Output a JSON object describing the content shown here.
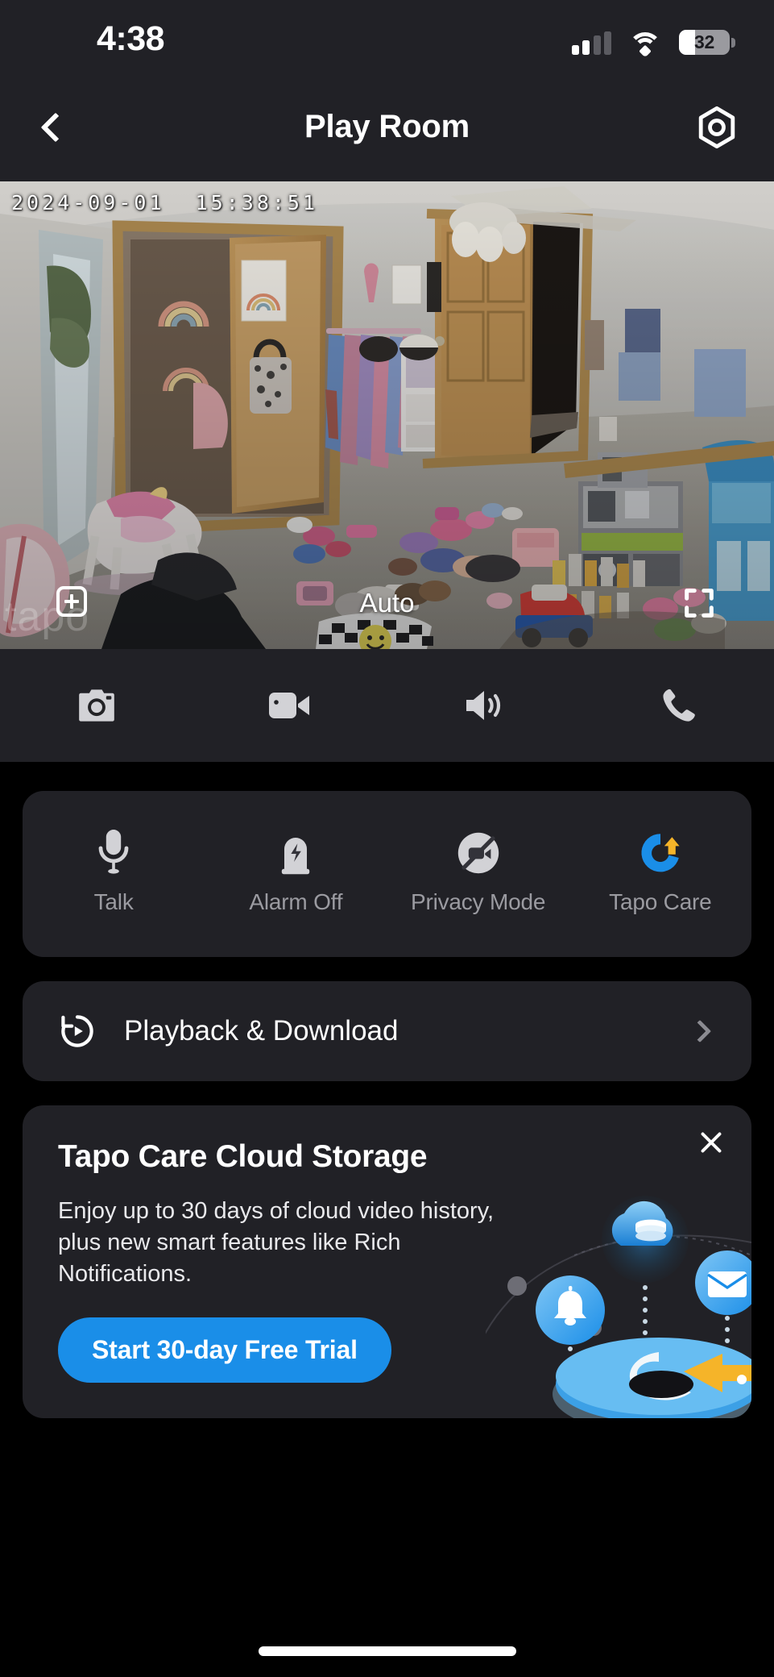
{
  "status_bar": {
    "time": "4:38",
    "battery_percent": "32",
    "battery_level": 32,
    "cellular_bars_filled": 2,
    "cellular_bars_total": 4,
    "wifi_icon": "wifi-icon"
  },
  "header": {
    "title": "Play Room",
    "back_icon": "chevron-left-icon",
    "settings_icon": "settings-hexagon-icon"
  },
  "video": {
    "timestamp": "2024-09-01  15:38:51",
    "watermark": "tapo",
    "quality_label": "Auto",
    "zoom_icon": "zoom-in-icon",
    "fullscreen_icon": "fullscreen-icon",
    "scene_description": "Live camera feed of a child's play room with toys on carpet"
  },
  "control_bar": {
    "buttons": [
      {
        "name": "snapshot-button",
        "icon": "camera-icon"
      },
      {
        "name": "record-button",
        "icon": "video-camera-icon"
      },
      {
        "name": "sound-button",
        "icon": "speaker-icon"
      },
      {
        "name": "call-button",
        "icon": "phone-icon"
      }
    ]
  },
  "quick_actions": [
    {
      "label": "Talk",
      "icon": "microphone-icon"
    },
    {
      "label": "Alarm Off",
      "icon": "siren-icon"
    },
    {
      "label": "Privacy Mode",
      "icon": "camera-off-icon"
    },
    {
      "label": "Tapo Care",
      "icon": "tapo-care-icon"
    }
  ],
  "playback_row": {
    "label": "Playback & Download",
    "icon": "playback-rewind-icon",
    "chevron": "chevron-right-icon"
  },
  "promo": {
    "title": "Tapo Care Cloud Storage",
    "description": "Enjoy up to 30 days of cloud video history, plus new smart features like Rich Notifications.",
    "cta_label": "Start 30-day Free Trial",
    "close_icon": "close-icon",
    "illustration_icons": [
      "cloud-database-icon",
      "bell-icon",
      "envelope-icon",
      "tapo-disk-icon"
    ]
  },
  "colors": {
    "accent_blue": "#1a8ee8",
    "card_bg": "#212126",
    "page_bg": "#000000",
    "muted_text": "#9b9ba1",
    "tapo_yellow": "#f5b429"
  }
}
